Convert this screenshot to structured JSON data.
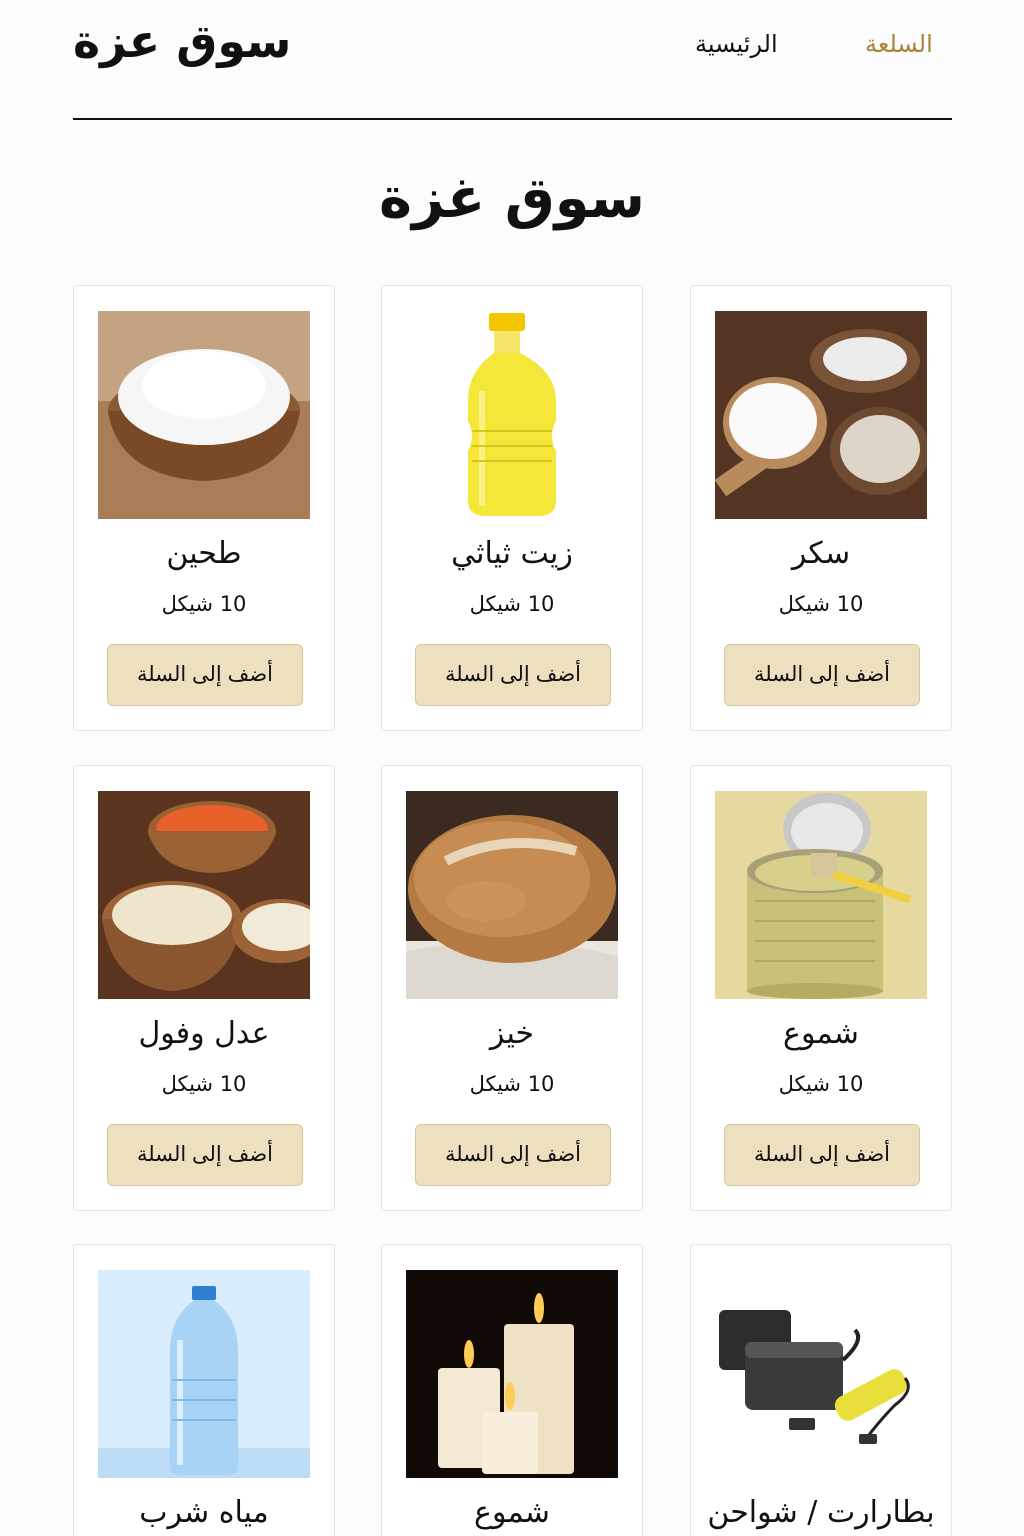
{
  "header": {
    "logo": "سوق عزة",
    "nav_home": "الرئيسية",
    "nav_cart": "السلعة"
  },
  "main": {
    "title": "سوق غزة"
  },
  "products": [
    {
      "name": "سكر",
      "price": "10 شيكل",
      "button": "أضف إلى السلة",
      "image": "sugar-image"
    },
    {
      "name": "زيت ثياثي",
      "price": "10 شيكل",
      "button": "أضف إلى السلة",
      "image": "oil-bottle-image"
    },
    {
      "name": "طحين",
      "price": "10 شيكل",
      "button": "أضف إلى السلة",
      "image": "flour-bowl-image"
    },
    {
      "name": "شموع",
      "price": "10 شيكل",
      "button": "أضف إلى السلة",
      "image": "milk-can-image"
    },
    {
      "name": "خيز",
      "price": "10 شيكل",
      "button": "أضف إلى السلة",
      "image": "bread-image"
    },
    {
      "name": "عدل وفول",
      "price": "10 شيكل",
      "button": "أضف إلى السلة",
      "image": "lentils-beans-image"
    },
    {
      "name": "بطارارت / شواحن",
      "image": "batteries-image"
    },
    {
      "name": "شموع",
      "image": "candles-image"
    },
    {
      "name": "مياه شرب",
      "image": "water-bottle-image"
    }
  ],
  "colors": {
    "accent": "#a8843a",
    "button_bg": "#ede0bf",
    "button_border": "#d8c79d"
  }
}
